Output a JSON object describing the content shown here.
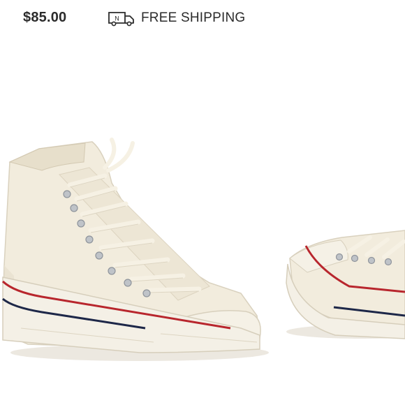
{
  "listing": {
    "price": "$85.00",
    "shipping_label": "FREE SHIPPING",
    "shipping_icon": "delivery-truck-icon",
    "shipping_icon_letter": "N"
  },
  "photo": {
    "subject": "product-photo",
    "colors": {
      "canvas": "#f2ecdd",
      "sole": "#f4f0e6",
      "red_stripe": "#b8262d",
      "navy_stripe": "#1d2748",
      "lace": "#f6f1e4",
      "eyelet": "#bfc3c8"
    }
  }
}
